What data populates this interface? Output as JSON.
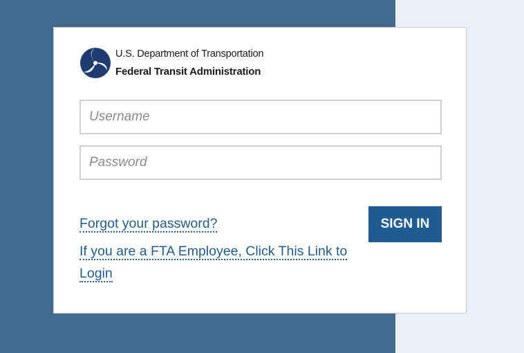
{
  "brand": {
    "department": "U.S. Department of Transportation",
    "agency": "Federal Transit Administration",
    "seal_icon": "dot-triskelion-seal-icon"
  },
  "form": {
    "username_placeholder": "Username",
    "username_value": "",
    "password_placeholder": "Password",
    "password_value": "",
    "submit_label": "SIGN IN"
  },
  "links": {
    "forgot_password": "Forgot your password?",
    "employee_login": "If you are a FTA Employee, Click This Link to Login"
  },
  "colors": {
    "left_panel": "#436a8c",
    "right_background": "#eaeff6",
    "button": "#205c91",
    "link": "#245a87"
  }
}
